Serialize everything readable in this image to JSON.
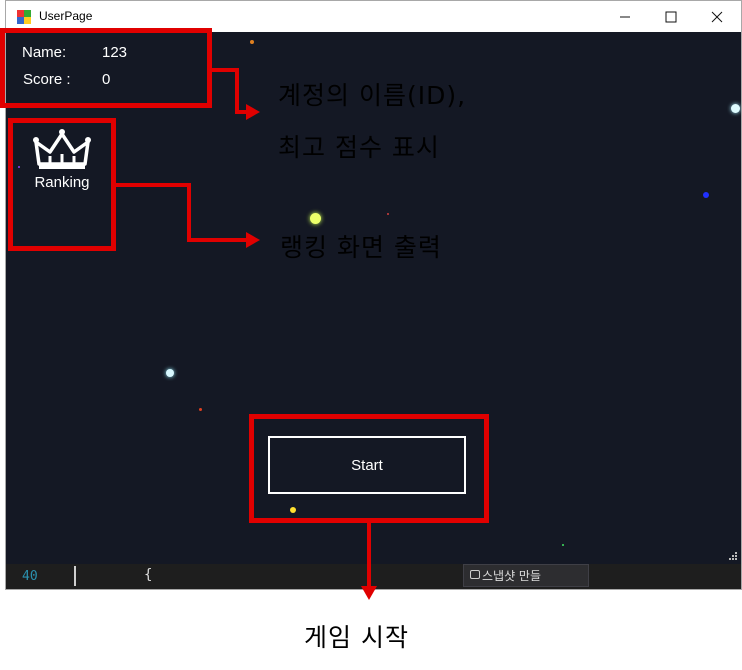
{
  "window": {
    "title": "UserPage",
    "minimize": "—",
    "maximize": "☐",
    "close": "✕"
  },
  "user_info": {
    "name_label": "Name:",
    "name_value": "123",
    "score_label": "Score :",
    "score_value": "0"
  },
  "ranking": {
    "label": "Ranking",
    "icon": "crown-icon"
  },
  "start": {
    "label": "Start"
  },
  "background_editor": {
    "line_number": "40",
    "brace": "{",
    "snapshot_label": "스냅샷 만들"
  },
  "annotations": {
    "info_line1": "계정의 이름(ID),",
    "info_line2": "최고 점수 표시",
    "ranking_text": "랭킹 화면 출력",
    "start_text": "게임 시작"
  },
  "colors": {
    "annotation_red": "#e00000",
    "game_background": "#141824",
    "button_border": "#ffffff"
  }
}
